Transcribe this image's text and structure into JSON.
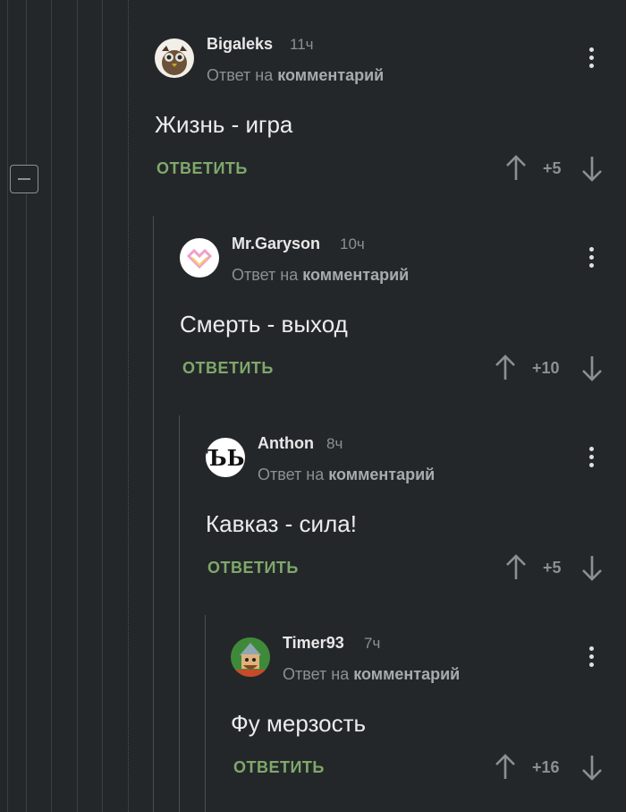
{
  "ui": {
    "reply_prefix": "Ответ на",
    "reply_target": "комментарий",
    "reply_button": "ОТВЕТИТЬ"
  },
  "comments": [
    {
      "author": "Bigaleks",
      "time": "11ч",
      "text": "Жизнь - игра",
      "score": "+5"
    },
    {
      "author": "Mr.Garyson",
      "time": "10ч",
      "text": "Смерть - выход",
      "score": "+10"
    },
    {
      "author": "Anthon",
      "time": "8ч",
      "text": "Кавказ - сила!",
      "score": "+5"
    },
    {
      "author": "Timer93",
      "time": "7ч",
      "text": "Фу мерзость",
      "score": "+16"
    }
  ],
  "icons": {
    "collapse": "minus-square-icon",
    "more": "vertical-dots-icon",
    "up": "arrow-up-icon",
    "down": "arrow-down-icon"
  }
}
